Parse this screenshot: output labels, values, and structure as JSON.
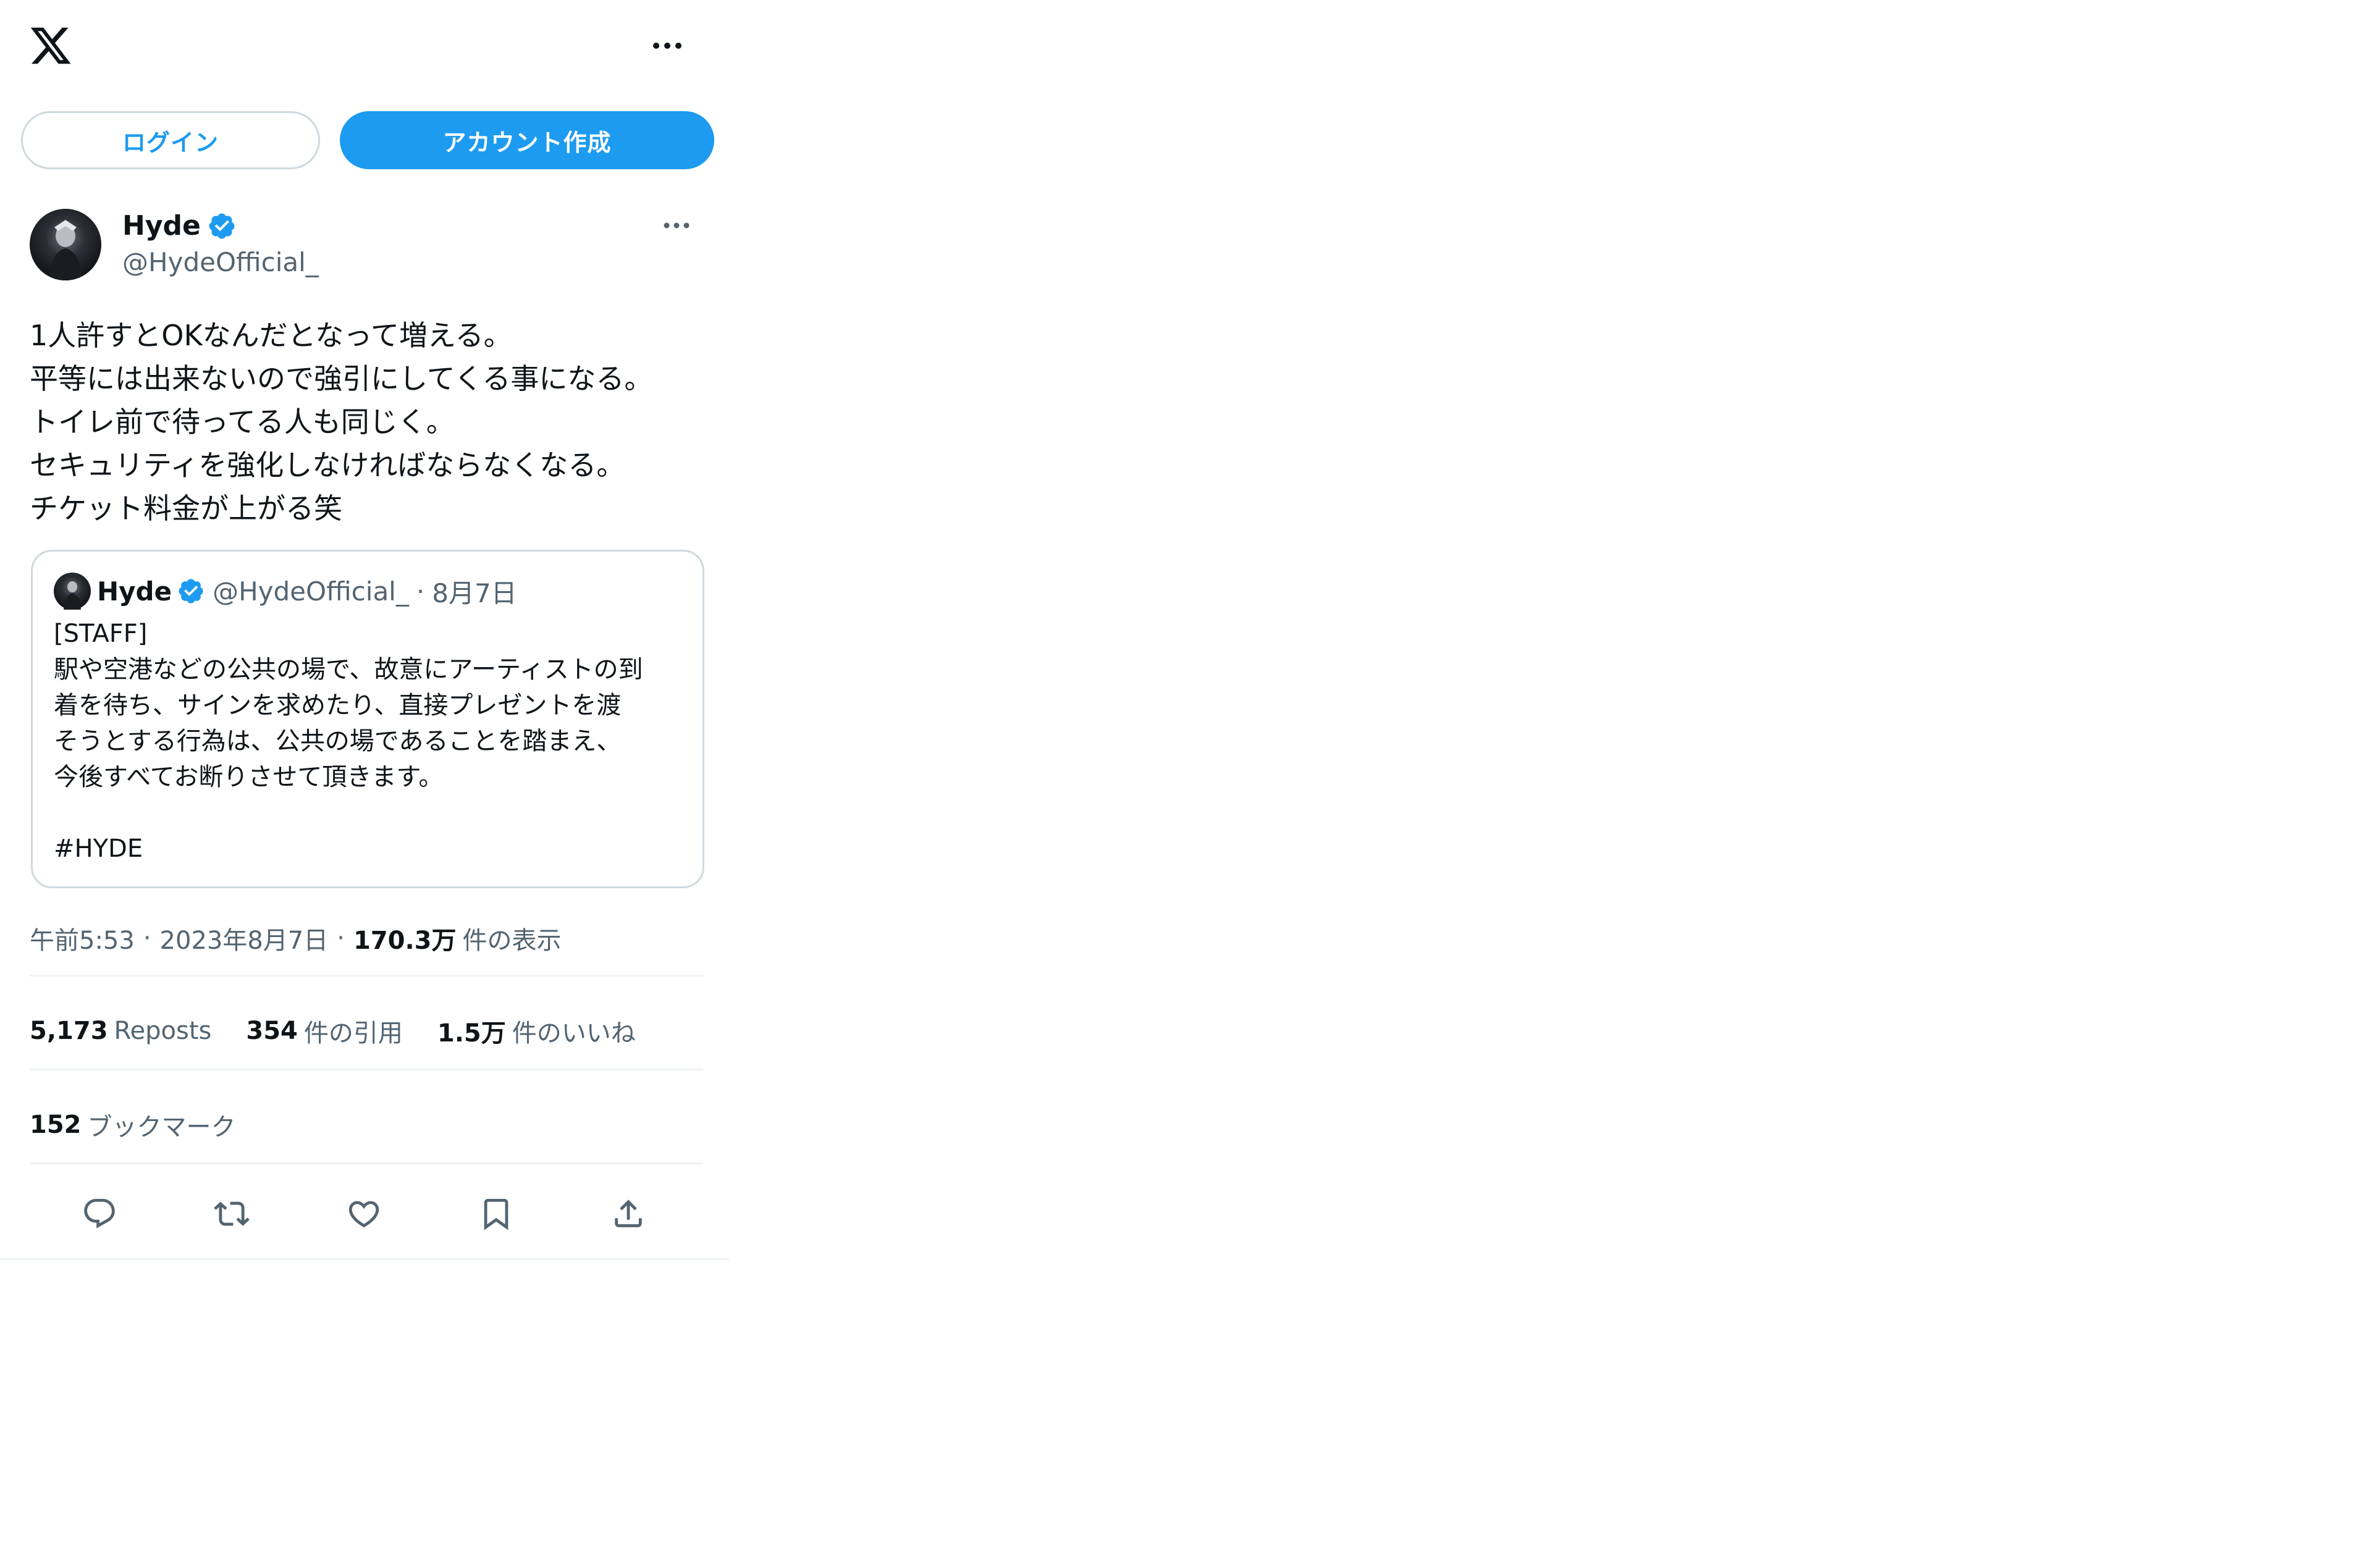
{
  "header": {
    "logo_icon": "x-logo-icon",
    "more_icon": "more-horizontal-icon"
  },
  "auth": {
    "login_label": "ログイン",
    "signup_label": "アカウント作成"
  },
  "tweet": {
    "author": {
      "name": "Hyde",
      "handle": "@HydeOfficial_",
      "verified": true
    },
    "text_lines": [
      "1人許すとOKなんだとなって増える。",
      "平等には出来ないので強引にしてくる事になる。",
      "トイレ前で待ってる人も同じく。",
      "セキュリティを強化しなければならなくなる。",
      "チケット料金が上がる笑"
    ],
    "quoted": {
      "name": "Hyde",
      "handle": "@HydeOfficial_",
      "separator": "·",
      "date": "8月7日",
      "text_lines": [
        "[STAFF]",
        "駅や空港などの公共の場で、故意にアーティストの到",
        "着を待ち、サインを求めたり、直接プレゼントを渡",
        "そうとする行為は、公共の場であることを踏まえ、",
        "今後すべてお断りさせて頂きます。",
        "",
        "#HYDE"
      ]
    },
    "meta": {
      "time": "午前5:53",
      "separator": "·",
      "date": "2023年8月7日",
      "views_count": "170.3万",
      "views_label": "件の表示"
    },
    "stats": {
      "reposts_count": "5,173",
      "reposts_label": "Reposts",
      "quotes_count": "354",
      "quotes_label": "件の引用",
      "likes_count": "1.5万",
      "likes_label": "件のいいね",
      "bookmarks_count": "152",
      "bookmarks_label": "ブックマーク"
    },
    "actions": [
      "reply-icon",
      "repost-icon",
      "like-icon",
      "bookmark-icon",
      "share-icon"
    ]
  },
  "colors": {
    "accent": "#1d9bf0",
    "text_primary": "#0f1419",
    "text_secondary": "#536471",
    "border": "#cfd9de",
    "divider": "#eff3f4"
  }
}
